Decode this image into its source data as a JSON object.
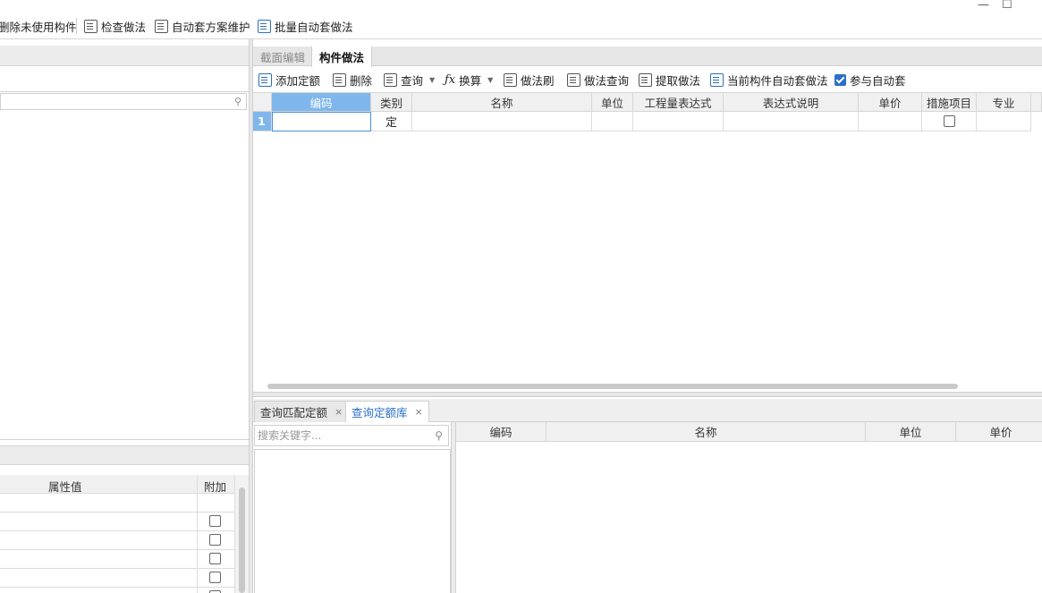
{
  "toolbar": {
    "delete_unused": "删除未使用构件",
    "check_method": "检查做法",
    "auto_scheme": "自动套方案维护",
    "batch_auto": "批量自动套做法"
  },
  "window_controls": {
    "minimize": "—",
    "maximize": "☐"
  },
  "left_panel": {
    "prop_table": {
      "col_value": "属性值",
      "col_add": "附加"
    }
  },
  "tabs": [
    {
      "label": "截面编辑",
      "active": false
    },
    {
      "label": "构件做法",
      "active": true
    }
  ],
  "method_toolbar": {
    "add_quota": "添加定额",
    "delete": "删除",
    "query": "查询",
    "convert": "换算",
    "method_brush": "做法刷",
    "method_query": "做法查询",
    "extract_method": "提取做法",
    "current_auto": "当前构件自动套做法",
    "participate_auto": "参与自动套",
    "participate_auto_checked": true
  },
  "method_grid": {
    "columns": [
      "编码",
      "类别",
      "名称",
      "单位",
      "工程量表达式",
      "表达式说明",
      "单价",
      "措施项目",
      "专业"
    ],
    "rows": [
      {
        "num": "1",
        "code": "",
        "category": "定",
        "name": "",
        "unit": "",
        "expr": "",
        "expr_desc": "",
        "price": "",
        "measure": false,
        "major": ""
      }
    ]
  },
  "lower_tabs": [
    {
      "label": "查询匹配定额",
      "close": "×",
      "active": false
    },
    {
      "label": "查询定额库",
      "close": "×",
      "active": true
    }
  ],
  "library": {
    "search_placeholder": "搜索关键字...",
    "columns": [
      "编码",
      "名称",
      "单位",
      "单价"
    ]
  },
  "colors": {
    "accent": "#2a6fc9",
    "selected_header": "#7fb7ec"
  }
}
